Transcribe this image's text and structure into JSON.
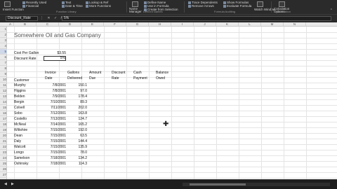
{
  "ribbon": {
    "function_library": {
      "insert_function": "Insert Function",
      "recently_used": "Recently Used",
      "financial": "Financial",
      "text": "Text",
      "date_time": "Date & Time",
      "lookup": "Lookup & Ref",
      "more_functions": "More Functions",
      "group_label": "Function Library"
    },
    "defined_names": {
      "name_manager": "Name Manager",
      "define_name": "Define Name",
      "use_in_formula": "Use in Formula",
      "create_from_selection": "Create from Selection",
      "group_label": "Defined Names"
    },
    "formula_auditing": {
      "trace_dependents": "Trace Dependents",
      "show_formulas": "Show Formulas",
      "remove_arrows": "Remove Arrows",
      "evaluate_formula": "Evaluate Formula",
      "watch_window": "Watch Window",
      "group_label": "Formula Auditing"
    },
    "calculation": {
      "options": "Calculation Options",
      "group_label": "Calculation"
    }
  },
  "formula_bar": {
    "name_box": "Discount_Rate",
    "fx_symbol": "fx",
    "value": "5%"
  },
  "grid": {
    "columns": [
      "A",
      "B",
      "C",
      "D",
      "E",
      "F",
      "G",
      "H",
      "I",
      "J",
      "K",
      "L",
      "M",
      "N"
    ],
    "rows": [
      "1",
      "2",
      "3",
      "4",
      "5",
      "6",
      "7",
      "8",
      "9",
      "10",
      "11",
      "12",
      "13",
      "14",
      "15",
      "16",
      "17",
      "18",
      "19",
      "20",
      "21",
      "22",
      "23",
      "24",
      "25",
      "26",
      "27"
    ],
    "selected_row": "5",
    "title": "Somewhere Oil and Gas Company",
    "cost_label": "Cost Per Gallon",
    "cost_value": "$3.55",
    "discount_label": "Discount Rate",
    "discount_value": "5%",
    "headers": {
      "customer": "Customer",
      "invoice_date_1": "Invoice",
      "invoice_date_2": "Date",
      "gallons_1": "Gallons",
      "gallons_2": "Delivered",
      "amount_1": "Amount",
      "amount_2": "Due",
      "discount_1": "Discount",
      "discount_2": "Rate",
      "cash_1": "Cash",
      "cash_2": "Payment",
      "balance_1": "Balance",
      "balance_2": "Owed"
    },
    "records": [
      {
        "customer": "Murphy",
        "date": "7/8/2001",
        "gallons": "150.1"
      },
      {
        "customer": "Higgins",
        "date": "7/8/2001",
        "gallons": "97.0"
      },
      {
        "customer": "Belden",
        "date": "7/9/2001",
        "gallons": "178.4"
      },
      {
        "customer": "Bergin",
        "date": "7/10/2001",
        "gallons": "89.3"
      },
      {
        "customer": "Colvell",
        "date": "7/11/2001",
        "gallons": "202.0"
      },
      {
        "customer": "Sobo",
        "date": "7/12/2001",
        "gallons": "163.8"
      },
      {
        "customer": "Costello",
        "date": "7/13/2001",
        "gallons": "124.7"
      },
      {
        "customer": "McNeal",
        "date": "7/14/2001",
        "gallons": "165.2"
      },
      {
        "customer": "Wiltshire",
        "date": "7/15/2001",
        "gallons": "192.0"
      },
      {
        "customer": "Dean",
        "date": "7/15/2001",
        "gallons": "63.5"
      },
      {
        "customer": "Daly",
        "date": "7/15/2001",
        "gallons": "144.4"
      },
      {
        "customer": "Walcott",
        "date": "7/15/2001",
        "gallons": "135.9"
      },
      {
        "customer": "Longo",
        "date": "7/15/2001",
        "gallons": "78.0"
      },
      {
        "customer": "Samelson",
        "date": "7/18/2001",
        "gallons": "134.2"
      },
      {
        "customer": "Oshinsky",
        "date": "7/18/2001",
        "gallons": "114.3"
      }
    ]
  }
}
